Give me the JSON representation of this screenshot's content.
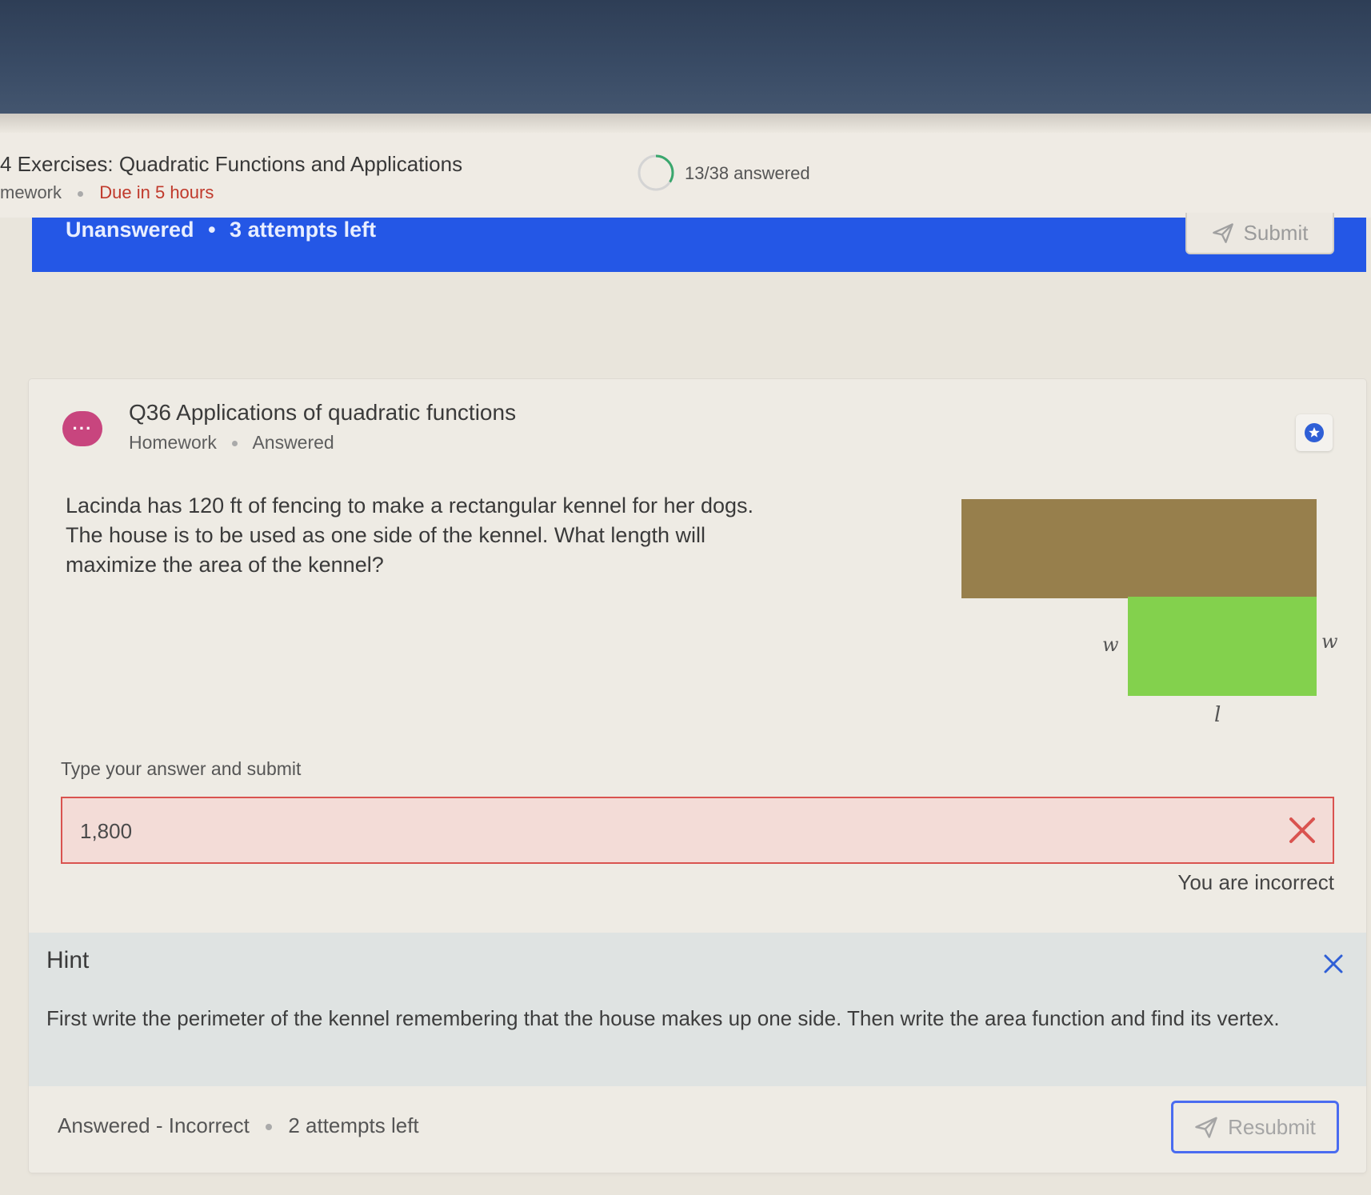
{
  "header": {
    "course_title": "4 Exercises: Quadratic Functions and Applications",
    "course_type": "mework",
    "due": "Due in 5 hours",
    "progress_text": "13/38 answered",
    "progress_fraction": 0.342
  },
  "status_bar": {
    "state": "Unanswered",
    "attempts": "3 attempts left",
    "submit_label": "Submit"
  },
  "question": {
    "avatar": "···",
    "title": "Q36 Applications of quadratic functions",
    "type": "Homework",
    "status": "Answered",
    "text": "Lacinda has 120 ft of fencing to make a rectangular kennel for her dogs. The house is to be used as one side of the kennel. What length will maximize the area of the kennel?",
    "diagram": {
      "left_label": "w",
      "right_label": "w",
      "bottom_label": "l",
      "house_color": "#977f4c",
      "kennel_color": "#83d14d"
    }
  },
  "answer": {
    "label": "Type your answer and submit",
    "value": "1,800",
    "feedback": "You are incorrect"
  },
  "hint": {
    "title": "Hint",
    "text": "First write the perimeter of the kennel remembering that the house makes up one side. Then write the area function and find its vertex."
  },
  "footer": {
    "status": "Answered - Incorrect",
    "attempts": "2 attempts left",
    "resubmit_label": "Resubmit"
  },
  "colors": {
    "accent_blue": "#2457e6",
    "error_red": "#d9534f",
    "due_red": "#c0392b"
  }
}
